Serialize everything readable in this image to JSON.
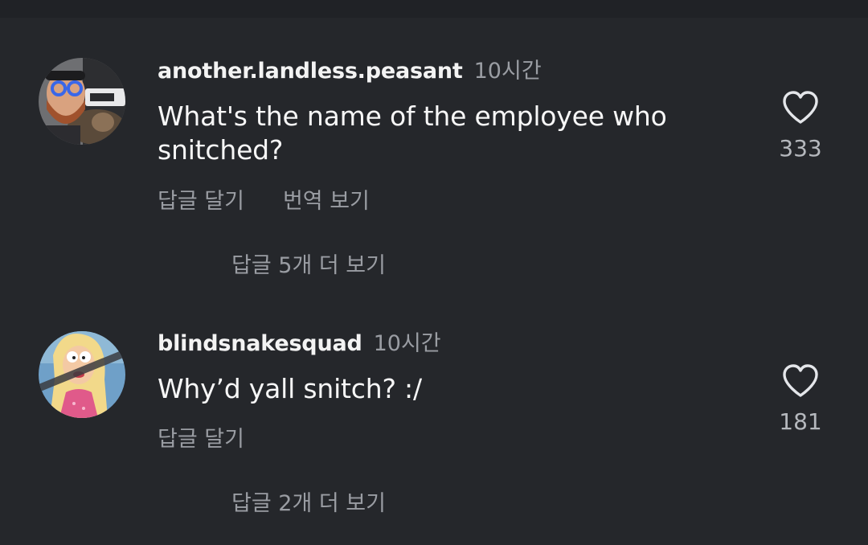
{
  "comments": [
    {
      "username": "another.landless.peasant",
      "time": "10시간",
      "text": "What's the name of the employee who snitched?",
      "actions": [
        "답글 달기",
        "번역 보기"
      ],
      "like_count": "333",
      "view_replies": "답글 5개 더 보기"
    },
    {
      "username": "blindsnakesquad",
      "time": "10시간",
      "text": "Why’d yall snitch? :/",
      "actions": [
        "답글 달기"
      ],
      "like_count": "181",
      "view_replies": "답글 2개 더 보기"
    }
  ],
  "icons": {
    "like": "heart-outline-icon"
  },
  "colors": {
    "background": "#25272b",
    "secondary_text": "#9a9da3",
    "primary_text": "#f5f5f5"
  }
}
